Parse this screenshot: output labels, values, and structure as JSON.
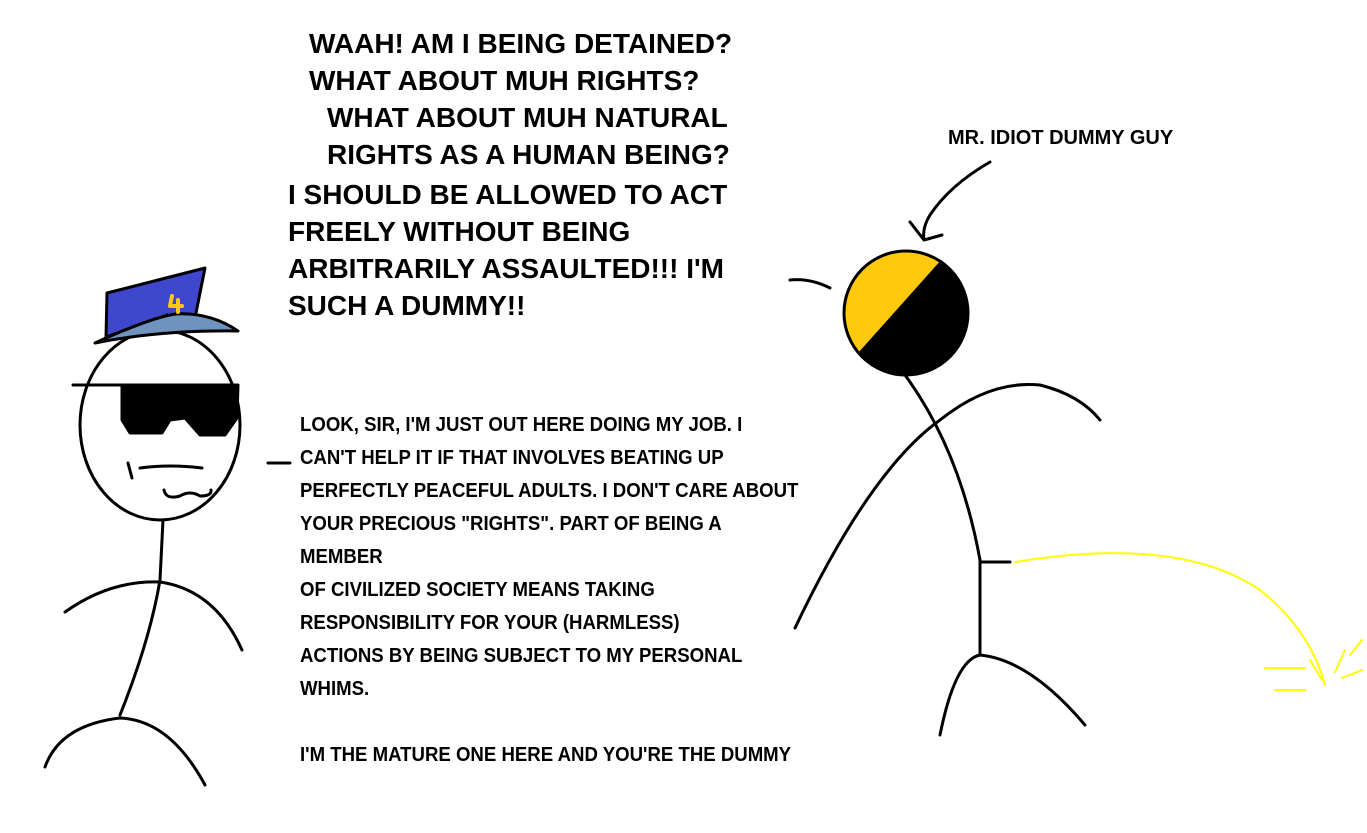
{
  "colors": {
    "hat": "#3f48cc",
    "hat_brim": "#7092be",
    "badge": "#ffc90e",
    "flag_yellow": "#ffc90e",
    "flag_black": "#000000",
    "stream": "#ffff00"
  },
  "protester_speech": [
    "WAAH! AM I BEING DETAINED?",
    "WHAT ABOUT MUH RIGHTS?",
    "WHAT ABOUT MUH NATURAL",
    "RIGHTS AS A HUMAN BEING?",
    "I SHOULD BE ALLOWED TO ACT",
    "FREELY WITHOUT BEING",
    "ARBITRARILY ASSAULTED!!! I'M",
    "SUCH A DUMMY!!"
  ],
  "protester_label": "MR. IDIOT DUMMY GUY",
  "cop_speech": [
    "LOOK, SIR, I'M JUST OUT HERE DOING MY JOB. I",
    "CAN'T HELP IT IF THAT INVOLVES BEATING UP",
    "PERFECTLY PEACEFUL ADULTS. I DON'T CARE ABOUT",
    "YOUR PRECIOUS \"RIGHTS\". PART OF BEING A",
    "MEMBER",
    "OF CIVILIZED SOCIETY MEANS TAKING",
    "RESPONSIBILITY FOR YOUR (HARMLESS)",
    "ACTIONS BY BEING SUBJECT TO MY PERSONAL",
    "WHIMS.",
    "I'M THE MATURE ONE HERE AND YOU'RE THE  DUMMY"
  ]
}
